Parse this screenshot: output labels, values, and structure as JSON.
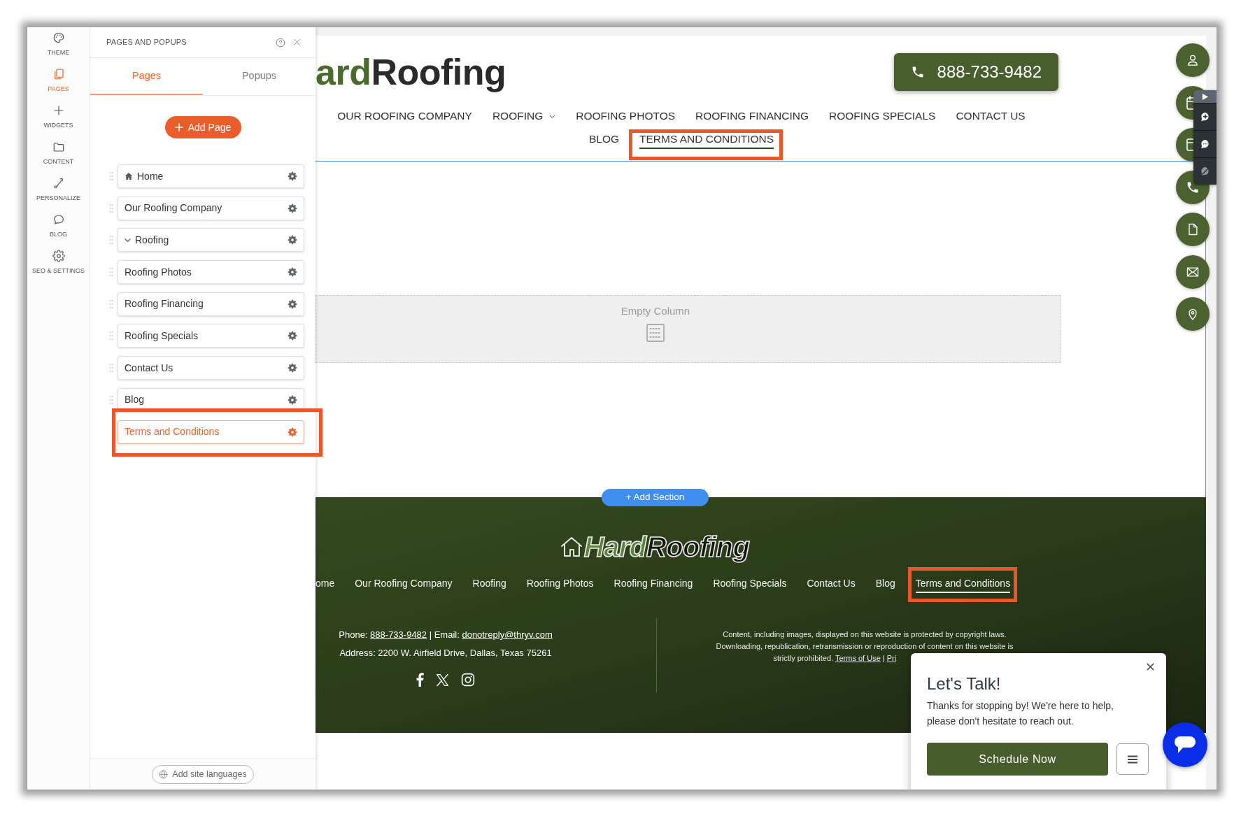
{
  "rail": [
    {
      "label": "THEME",
      "selected": false
    },
    {
      "label": "PAGES",
      "selected": true
    },
    {
      "label": "WIDGETS",
      "selected": false
    },
    {
      "label": "CONTENT",
      "selected": false
    },
    {
      "label": "PERSONALIZE",
      "selected": false
    },
    {
      "label": "BLOG",
      "selected": false
    },
    {
      "label": "SEO & SETTINGS",
      "selected": false
    }
  ],
  "panel": {
    "title": "PAGES AND POPUPS",
    "tabs": [
      {
        "label": "Pages",
        "selected": true
      },
      {
        "label": "Popups",
        "selected": false
      }
    ],
    "add_button": "Add Page",
    "pages": [
      {
        "label": "Home",
        "kind": "home",
        "selected": false,
        "highlighted": false
      },
      {
        "label": "Our Roofing Company",
        "kind": "page",
        "selected": false,
        "highlighted": false
      },
      {
        "label": "Roofing",
        "kind": "folder",
        "selected": false,
        "highlighted": false
      },
      {
        "label": "Roofing Photos",
        "kind": "page",
        "selected": false,
        "highlighted": false
      },
      {
        "label": "Roofing Financing",
        "kind": "page",
        "selected": false,
        "highlighted": false
      },
      {
        "label": "Roofing Specials",
        "kind": "page",
        "selected": false,
        "highlighted": false
      },
      {
        "label": "Contact Us",
        "kind": "page",
        "selected": false,
        "highlighted": false
      },
      {
        "label": "Blog",
        "kind": "page",
        "selected": false,
        "highlighted": false
      },
      {
        "label": "Terms and Conditions",
        "kind": "page",
        "selected": true,
        "highlighted": true
      }
    ],
    "languages_button": "Add site languages"
  },
  "site": {
    "logo": {
      "prefix": "ard",
      "suffix": "Roofing"
    },
    "phone_button": "888-733-9482",
    "nav": [
      {
        "label": "OUR ROOFING COMPANY",
        "dropdown": false,
        "selected": false,
        "highlighted": false
      },
      {
        "label": "ROOFING",
        "dropdown": true,
        "selected": false,
        "highlighted": false
      },
      {
        "label": "ROOFING PHOTOS",
        "dropdown": false,
        "selected": false,
        "highlighted": false
      },
      {
        "label": "ROOFING FINANCING",
        "dropdown": false,
        "selected": false,
        "highlighted": false
      },
      {
        "label": "ROOFING SPECIALS",
        "dropdown": false,
        "selected": false,
        "highlighted": false
      },
      {
        "label": "CONTACT US",
        "dropdown": false,
        "selected": false,
        "highlighted": false
      },
      {
        "label": "BLOG",
        "dropdown": false,
        "selected": false,
        "highlighted": false
      },
      {
        "label": "TERMS AND CONDITIONS",
        "dropdown": false,
        "selected": true,
        "highlighted": true
      }
    ],
    "empty_column": "Empty Column",
    "add_section": "+ Add Section",
    "footer": {
      "logo": {
        "prefix": "Hard",
        "suffix": "Roofing"
      },
      "nav": [
        {
          "label": "ome",
          "selected": false,
          "highlighted": false
        },
        {
          "label": "Our Roofing Company",
          "selected": false,
          "highlighted": false
        },
        {
          "label": "Roofing",
          "selected": false,
          "highlighted": false
        },
        {
          "label": "Roofing Photos",
          "selected": false,
          "highlighted": false
        },
        {
          "label": "Roofing Financing",
          "selected": false,
          "highlighted": false
        },
        {
          "label": "Roofing Specials",
          "selected": false,
          "highlighted": false
        },
        {
          "label": "Contact Us",
          "selected": false,
          "highlighted": false
        },
        {
          "label": "Blog",
          "selected": false,
          "highlighted": false
        },
        {
          "label": "Terms and Conditions",
          "selected": true,
          "highlighted": true
        }
      ],
      "contact": [
        {
          "text": "Phone: ",
          "link": false
        },
        {
          "text": "888-733-9482",
          "link": true
        },
        {
          "text": " | Email: ",
          "link": false
        },
        {
          "text": "donotreply@thryv.com",
          "link": true
        }
      ],
      "address": "Address: 2200 W. Airfield Drive, Dallas, Texas 75261",
      "copyright": [
        [
          {
            "text": "Content, including images, displayed on this website is protected by copyright laws.",
            "link": false
          }
        ],
        [
          {
            "text": "Downloading, republication, retransmission or reproduction of content on this website is",
            "link": false
          }
        ],
        [
          {
            "text": "strictly prohibited. ",
            "link": false
          },
          {
            "text": "Terms of Use",
            "link": true
          },
          {
            "text": " | ",
            "link": false
          },
          {
            "text": "Pri",
            "link": true
          }
        ]
      ]
    }
  },
  "chat": {
    "title": "Let's Talk!",
    "message": "Thanks for stopping by! We're here to help, please don't hesitate to reach out.",
    "button": "Schedule Now"
  }
}
